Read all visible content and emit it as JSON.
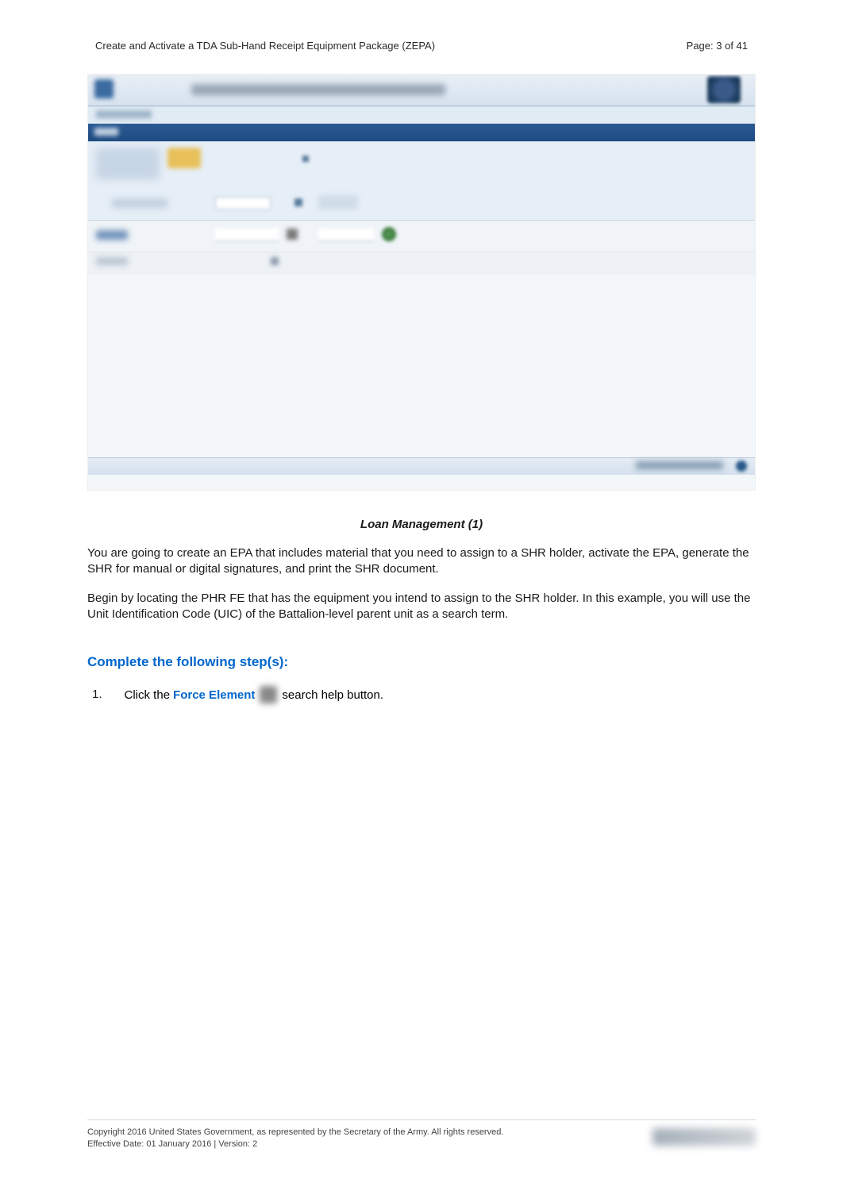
{
  "header": {
    "title": "Create and Activate a TDA Sub-Hand Receipt Equipment Package (ZEPA)",
    "page_label": "Page: 3 of 41"
  },
  "figure": {
    "caption": "Loan Management (1)"
  },
  "paragraphs": {
    "p1": "You are going to create an EPA that includes material that you need to assign to a SHR holder, activate the EPA, generate the SHR for manual or digital signatures, and print the SHR document.",
    "p2": "Begin by locating the PHR FE that has the equipment you intend to assign to the SHR holder. In this example, you will use the Unit Identification Code (UIC) of the Battalion-level parent unit as a search term."
  },
  "section": {
    "heading": "Complete the following step(s):"
  },
  "steps": [
    {
      "num": "1.",
      "pre": "Click the ",
      "link": "Force Element",
      "post": " search help button."
    }
  ],
  "footer": {
    "line1": "Copyright 2016 United States Government, as represented by the Secretary of the Army.   All rights reserved.",
    "line2": "Effective Date:  01 January 2016 | Version: 2"
  }
}
